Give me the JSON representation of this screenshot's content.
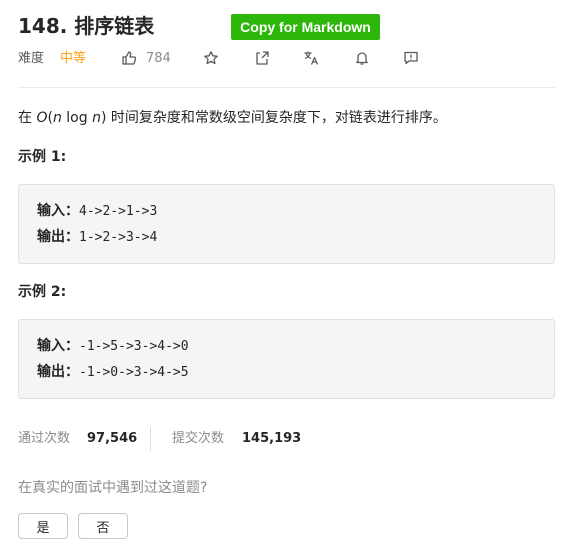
{
  "problem": {
    "title": "148. 排序链表",
    "copy_button": "Copy for Markdown",
    "difficulty_label": "难度",
    "difficulty": "中等",
    "likes": "784",
    "description_prefix": "在 ",
    "complexity_o": "O",
    "complexity_open": "(",
    "complexity_n": "n",
    "complexity_log": " log ",
    "complexity_n2": "n",
    "complexity_close": ")",
    "description_suffix": " 时间复杂度和常数级空间复杂度下，对链表进行排序。"
  },
  "examples": [
    {
      "title": "示例 1:",
      "input_label": "输入：",
      "input": "4->2->1->3",
      "output_label": "输出：",
      "output": "1->2->3->4"
    },
    {
      "title": "示例 2:",
      "input_label": "输入：",
      "input": "-1->5->3->4->0",
      "output_label": "输出：",
      "output": "-1->0->3->4->5"
    }
  ],
  "stats": {
    "accepted_label": "通过次数",
    "accepted": "97,546",
    "submitted_label": "提交次数",
    "submitted": "145,193"
  },
  "interview": {
    "question": "在真实的面试中遇到过这道题?",
    "yes": "是",
    "no": "否"
  },
  "icons": [
    "thumbs-up-icon",
    "star-icon",
    "share-icon",
    "translate-icon",
    "bell-icon",
    "feedback-icon"
  ],
  "colors": {
    "difficulty": "#ffa116",
    "copy_button": "#2db70b"
  }
}
